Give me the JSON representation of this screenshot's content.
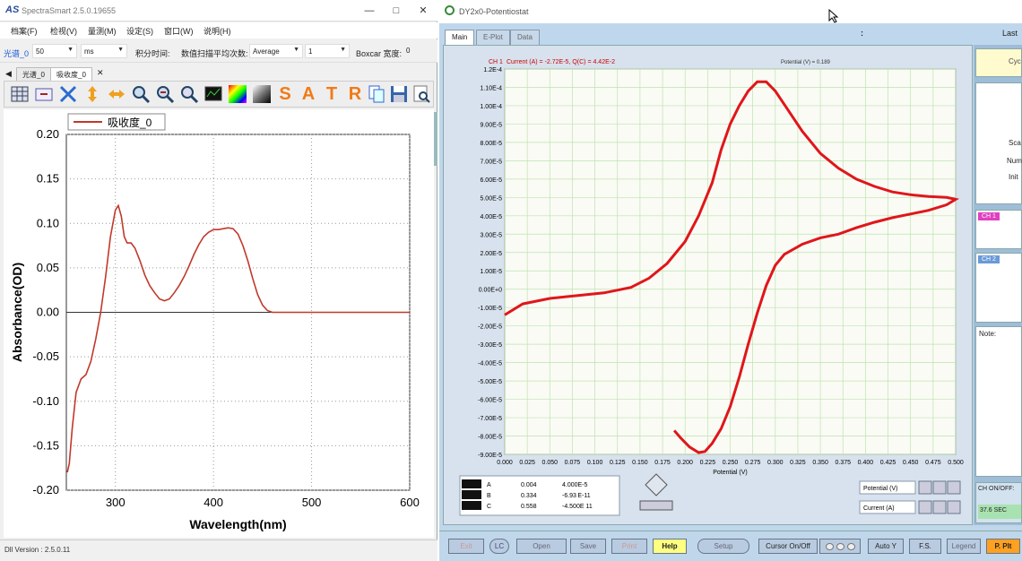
{
  "left_window": {
    "title": "SpectraSmart 2.5.0.19655",
    "logo": "AS",
    "menu": [
      "档案(F)",
      "检视(V)",
      "量测(M)",
      "设定(S)",
      "窗口(W)",
      "说明(H)"
    ],
    "params": {
      "spectrum_label": "光谱_0",
      "integration_value": "50",
      "integration_unit": "ms",
      "integration_label": "积分时间:",
      "avg_label": "数值扫描平均次数:",
      "avg_mode": "Average",
      "avg_count": "1",
      "boxcar_label": "Boxcar 宽度:",
      "boxcar_value": "0"
    },
    "tabs": [
      "光谱_0",
      "吸收度_0"
    ],
    "toolbar_icons": [
      "table-icon",
      "add-icon",
      "fit-icon",
      "vertical-scale-icon",
      "horizontal-scale-icon",
      "zoom-in-icon",
      "zoom-out-icon",
      "zoom-reset-icon",
      "display-icon",
      "spectrum-color-icon",
      "gradient-icon",
      "s-mode-icon",
      "a-mode-icon",
      "t-mode-icon",
      "r-mode-icon",
      "copy-icon",
      "save-icon",
      "print-preview-icon"
    ],
    "toolbar_letters": [
      "S",
      "A",
      "T",
      "R"
    ],
    "status": "Dll Version : 2.5.0.11"
  },
  "absorbance_chart": {
    "chart_data": {
      "type": "line",
      "legend": "吸收度_0",
      "xlabel": "Wavelength(nm)",
      "ylabel": "Absorbance(OD)",
      "xlim": [
        250,
        600
      ],
      "ylim": [
        -0.2,
        0.2
      ],
      "xticks": [
        "300",
        "400",
        "500",
        "600"
      ],
      "yticks": [
        "0.20",
        "0.15",
        "0.10",
        "0.05",
        "0.00",
        "-0.05",
        "-0.10",
        "-0.15",
        "-0.20"
      ],
      "grid": true,
      "series": [
        {
          "name": "吸收度_0",
          "color": "#c0392b",
          "x": [
            251,
            253,
            256,
            260,
            265,
            270,
            275,
            280,
            285,
            290,
            295,
            300,
            303,
            306,
            309,
            312,
            316,
            320,
            325,
            330,
            335,
            340,
            345,
            350,
            355,
            360,
            365,
            370,
            375,
            380,
            385,
            390,
            395,
            400,
            405,
            410,
            415,
            420,
            425,
            430,
            435,
            440,
            445,
            450,
            455,
            460,
            465,
            470,
            480,
            500,
            530,
            560,
            600
          ],
          "y": [
            -0.18,
            -0.17,
            -0.13,
            -0.09,
            -0.075,
            -0.07,
            -0.055,
            -0.03,
            0.0,
            0.04,
            0.085,
            0.115,
            0.12,
            0.108,
            0.085,
            0.078,
            0.078,
            0.072,
            0.058,
            0.042,
            0.03,
            0.022,
            0.015,
            0.013,
            0.015,
            0.022,
            0.03,
            0.04,
            0.052,
            0.065,
            0.076,
            0.085,
            0.09,
            0.093,
            0.093,
            0.094,
            0.095,
            0.094,
            0.088,
            0.075,
            0.058,
            0.038,
            0.02,
            0.008,
            0.002,
            0.0,
            0.0,
            0.0,
            0.0,
            0.0,
            0.0,
            0.0,
            0.0
          ]
        }
      ]
    }
  },
  "right_window": {
    "title": "DY2x0-Potentiostat",
    "tabs": [
      "Main",
      "E-Plot",
      "Data"
    ],
    "colon": ":",
    "last_label": "Last",
    "chart_header": {
      "channel": "CH 1",
      "current_text": "Current (A) = -2.72E-5, Q(C) = 4.42E-2",
      "potential_text": "Potential (V) = 0.189"
    },
    "cursor_table": [
      {
        "name": "A",
        "v": "0.004",
        "i": "4.000E-5"
      },
      {
        "name": "B",
        "v": "0.334",
        "i": "-6.93 E-11"
      },
      {
        "name": "C",
        "v": "0.558",
        "i": "-4.500E 11"
      }
    ],
    "axis_selectors": [
      "Potential (V)",
      "Current (A)"
    ],
    "side": {
      "cyc": "Cyc",
      "sca": "Sca",
      "num": "Num",
      "ini": "Init",
      "ch1": "CH 1",
      "ch2": "CH 2",
      "note": "Note:",
      "chonoff": "CH ON/OFF:",
      "temp": "37.6  SEC"
    },
    "bottom_buttons": [
      "Exit",
      "LC",
      "Open",
      "Save",
      "Print",
      "Help",
      "Setup",
      "Cursor On/Off",
      "Auto Y",
      "F.S.",
      "Legend",
      "P. Plt"
    ]
  },
  "cv_chart": {
    "chart_data": {
      "type": "line",
      "title": "",
      "xlabel": "Potential (V)",
      "ylabel": "",
      "xlim": [
        0.0,
        0.5
      ],
      "ylim": [
        -9e-05,
        0.00012
      ],
      "xticks": [
        "0.000",
        "0.025",
        "0.050",
        "0.075",
        "0.100",
        "0.125",
        "0.150",
        "0.175",
        "0.200",
        "0.225",
        "0.250",
        "0.275",
        "0.300",
        "0.325",
        "0.350",
        "0.375",
        "0.400",
        "0.425",
        "0.450",
        "0.475",
        "0.500"
      ],
      "yticks": [
        "1.2E-4",
        "1.10E-4",
        "1.00E-4",
        "9.00E-5",
        "8.00E-5",
        "7.00E-5",
        "6.00E-5",
        "5.00E-5",
        "4.00E-5",
        "3.00E-5",
        "2.00E-5",
        "1.00E-5",
        "0.00E+0",
        "-1.00E-5",
        "-2.00E-5",
        "-3.00E-5",
        "-4.00E-5",
        "-5.00E-5",
        "-6.00E-5",
        "-7.00E-5",
        "-8.00E-5",
        "-9.00E-5"
      ],
      "grid": true,
      "series": [
        {
          "name": "",
          "color": "#e0161b",
          "x": [
            0.0,
            0.02,
            0.05,
            0.08,
            0.11,
            0.14,
            0.16,
            0.18,
            0.2,
            0.215,
            0.23,
            0.24,
            0.25,
            0.26,
            0.27,
            0.28,
            0.29,
            0.3,
            0.315,
            0.33,
            0.35,
            0.37,
            0.39,
            0.41,
            0.43,
            0.45,
            0.47,
            0.49,
            0.5,
            0.49,
            0.47,
            0.45,
            0.43,
            0.41,
            0.39,
            0.37,
            0.35,
            0.33,
            0.31,
            0.3,
            0.29,
            0.28,
            0.27,
            0.26,
            0.25,
            0.24,
            0.23,
            0.222,
            0.215,
            0.205,
            0.195,
            0.188
          ],
          "y": [
            -1.4e-05,
            -8e-06,
            -5e-06,
            -3.5e-06,
            -2e-06,
            1e-06,
            6e-06,
            1.4e-05,
            2.6e-05,
            4e-05,
            5.8e-05,
            7.6e-05,
            9e-05,
            0.0001,
            0.000108,
            0.000113,
            0.000113,
            0.000108,
            9.7e-05,
            8.6e-05,
            7.4e-05,
            6.6e-05,
            6e-05,
            5.6e-05,
            5.3e-05,
            5.15e-05,
            5.05e-05,
            5e-05,
            4.9e-05,
            4.6e-05,
            4.3e-05,
            4.1e-05,
            3.9e-05,
            3.65e-05,
            3.35e-05,
            3e-05,
            2.8e-05,
            2.45e-05,
            1.9e-05,
            1.3e-05,
            2e-06,
            -1.3e-05,
            -3e-05,
            -4.8e-05,
            -6.4e-05,
            -7.6e-05,
            -8.4e-05,
            -8.85e-05,
            -8.9e-05,
            -8.6e-05,
            -8.1e-05,
            -7.7e-05
          ]
        }
      ]
    }
  }
}
